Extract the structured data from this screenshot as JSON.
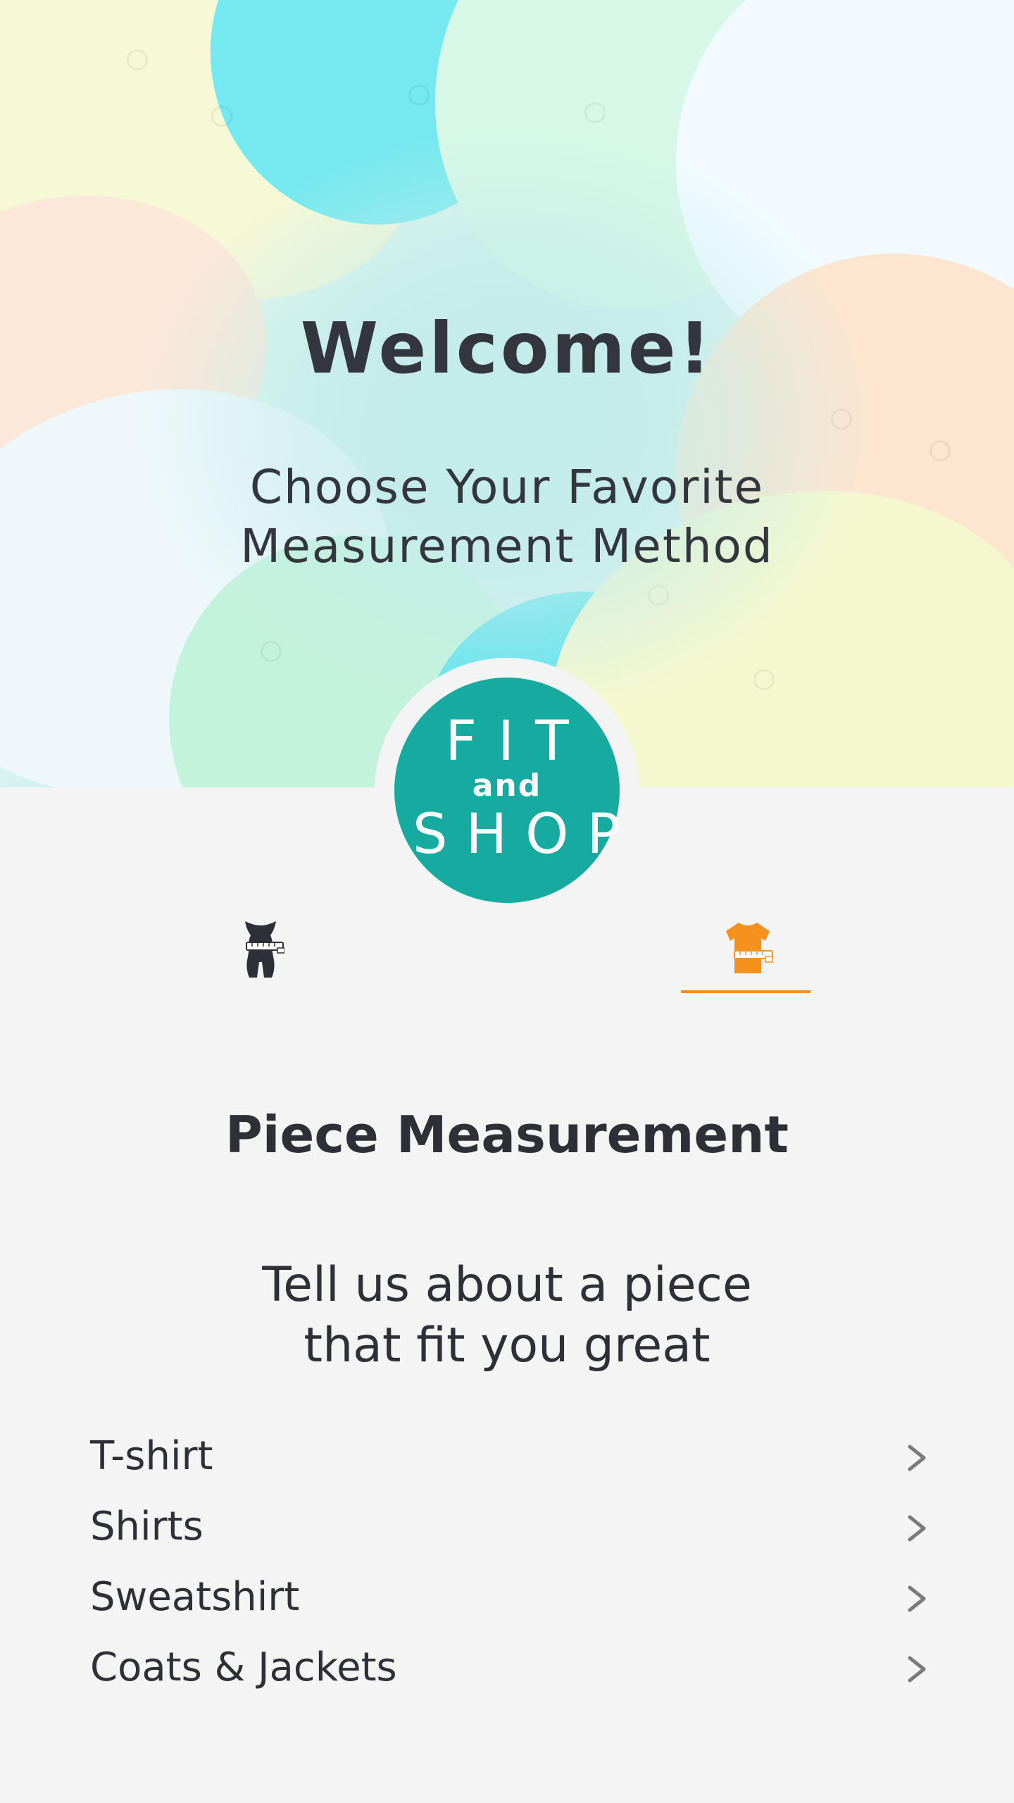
{
  "hero": {
    "title": "Welcome!",
    "subtitle_lines": [
      "Choose Your Favorite",
      "Measurement Method"
    ]
  },
  "logo": {
    "line1": "FIT",
    "line2": "and",
    "line3": "SHOP",
    "color": "#16aaa0"
  },
  "tabs": [
    {
      "icon": "body-measure-icon",
      "selected": false,
      "color": "#2f3037"
    },
    {
      "icon": "tshirt-measure-icon",
      "selected": true,
      "color": "#f5921e"
    }
  ],
  "section": {
    "title": "Piece Measurement",
    "description_lines": [
      "Tell us about a piece",
      "that fit you great"
    ]
  },
  "options": [
    {
      "label": "T-shirt",
      "icon": "chevron-right-icon"
    },
    {
      "label": "Shirts",
      "icon": "chevron-right-icon"
    },
    {
      "label": "Sweatshirt",
      "icon": "chevron-right-icon"
    },
    {
      "label": "Coats & Jackets",
      "icon": "chevron-right-icon"
    }
  ],
  "colors": {
    "accent": "#f5921e",
    "brand": "#16aaa0",
    "text": "#2f3037",
    "background": "#f4f4f4"
  }
}
